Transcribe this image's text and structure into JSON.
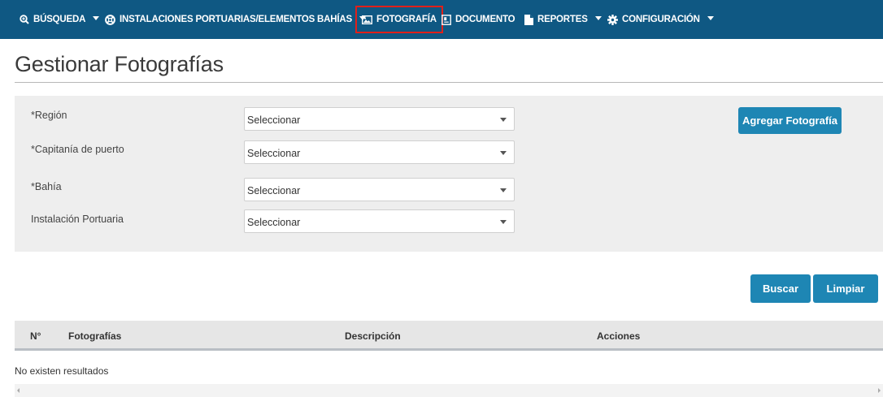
{
  "nav": {
    "items": [
      {
        "label": "BÚSQUEDA",
        "icon": "zoom-search-icon",
        "dropdown": true
      },
      {
        "label": "INSTALACIONES PORTUARIAS/ELEMENTOS BAHÍAS",
        "icon": "lifebuoy-icon",
        "dropdown": true
      },
      {
        "label": "FOTOGRAFÍA",
        "icon": "picture-icon",
        "dropdown": false,
        "active": true
      },
      {
        "label": "DOCUMENTO",
        "icon": "document-icon",
        "dropdown": false
      },
      {
        "label": "REPORTES",
        "icon": "file-icon",
        "dropdown": true
      },
      {
        "label": "CONFIGURACIÓN",
        "icon": "gear-icon",
        "dropdown": true
      }
    ]
  },
  "page": {
    "title": "Gestionar Fotografías"
  },
  "filters": {
    "fields": [
      {
        "label": "*Región",
        "value": "Seleccionar"
      },
      {
        "label": "*Capitanía de puerto",
        "value": "Seleccionar"
      },
      {
        "label": "*Bahía",
        "value": "Seleccionar"
      },
      {
        "label": "Instalación Portuaria",
        "value": "Seleccionar"
      }
    ],
    "add_button": "Agregar Fotografía"
  },
  "actions": {
    "search": "Buscar",
    "clear": "Limpiar"
  },
  "table": {
    "columns": [
      "N°",
      "Fotografías",
      "Descripción",
      "Acciones"
    ],
    "empty_message": "No existen resultados"
  },
  "colors": {
    "navbar": "#0f5883",
    "button": "#1e86b4",
    "active_outline": "#e0201a"
  }
}
